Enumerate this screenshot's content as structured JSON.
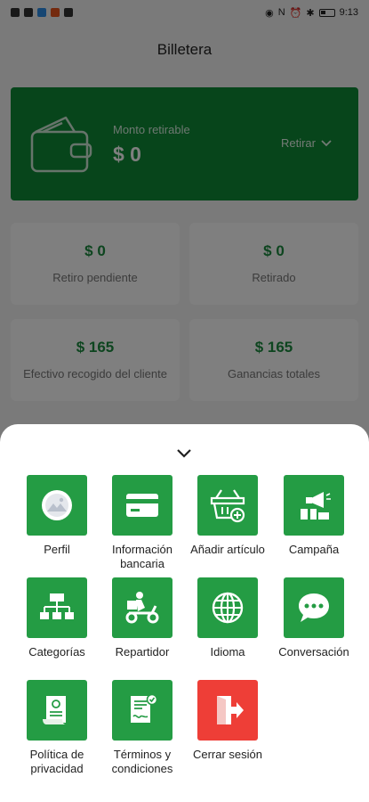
{
  "status_bar": {
    "time": "9:13"
  },
  "header": {
    "title": "Billetera"
  },
  "wallet": {
    "label": "Monto retirable",
    "amount": "$ 0",
    "withdraw_label": "Retirar"
  },
  "stats": [
    {
      "amount": "$ 0",
      "label": "Retiro pendiente"
    },
    {
      "amount": "$ 0",
      "label": "Retirado"
    },
    {
      "amount": "$ 165",
      "label": "Efectivo recogido del cliente"
    },
    {
      "amount": "$ 165",
      "label": "Ganancias totales"
    }
  ],
  "menu": [
    {
      "label": "Perfil",
      "icon": "profile-image-icon"
    },
    {
      "label": "Información bancaria",
      "icon": "credit-card-icon"
    },
    {
      "label": "Añadir artículo",
      "icon": "basket-add-icon"
    },
    {
      "label": "Campaña",
      "icon": "megaphone-gift-icon"
    },
    {
      "label": "Categorías",
      "icon": "hierarchy-icon"
    },
    {
      "label": "Repartidor",
      "icon": "delivery-scooter-icon"
    },
    {
      "label": "Idioma",
      "icon": "globe-icon"
    },
    {
      "label": "Conversación",
      "icon": "chat-bubble-icon"
    },
    {
      "label": "Política de privacidad",
      "icon": "policy-document-icon"
    },
    {
      "label": "Términos y condiciones",
      "icon": "terms-document-icon"
    },
    {
      "label": "Cerrar sesión",
      "icon": "logout-icon"
    }
  ],
  "colors": {
    "brand_green": "#0e8a37",
    "tile_green": "#249c44",
    "logout_red": "#ee3e37"
  }
}
